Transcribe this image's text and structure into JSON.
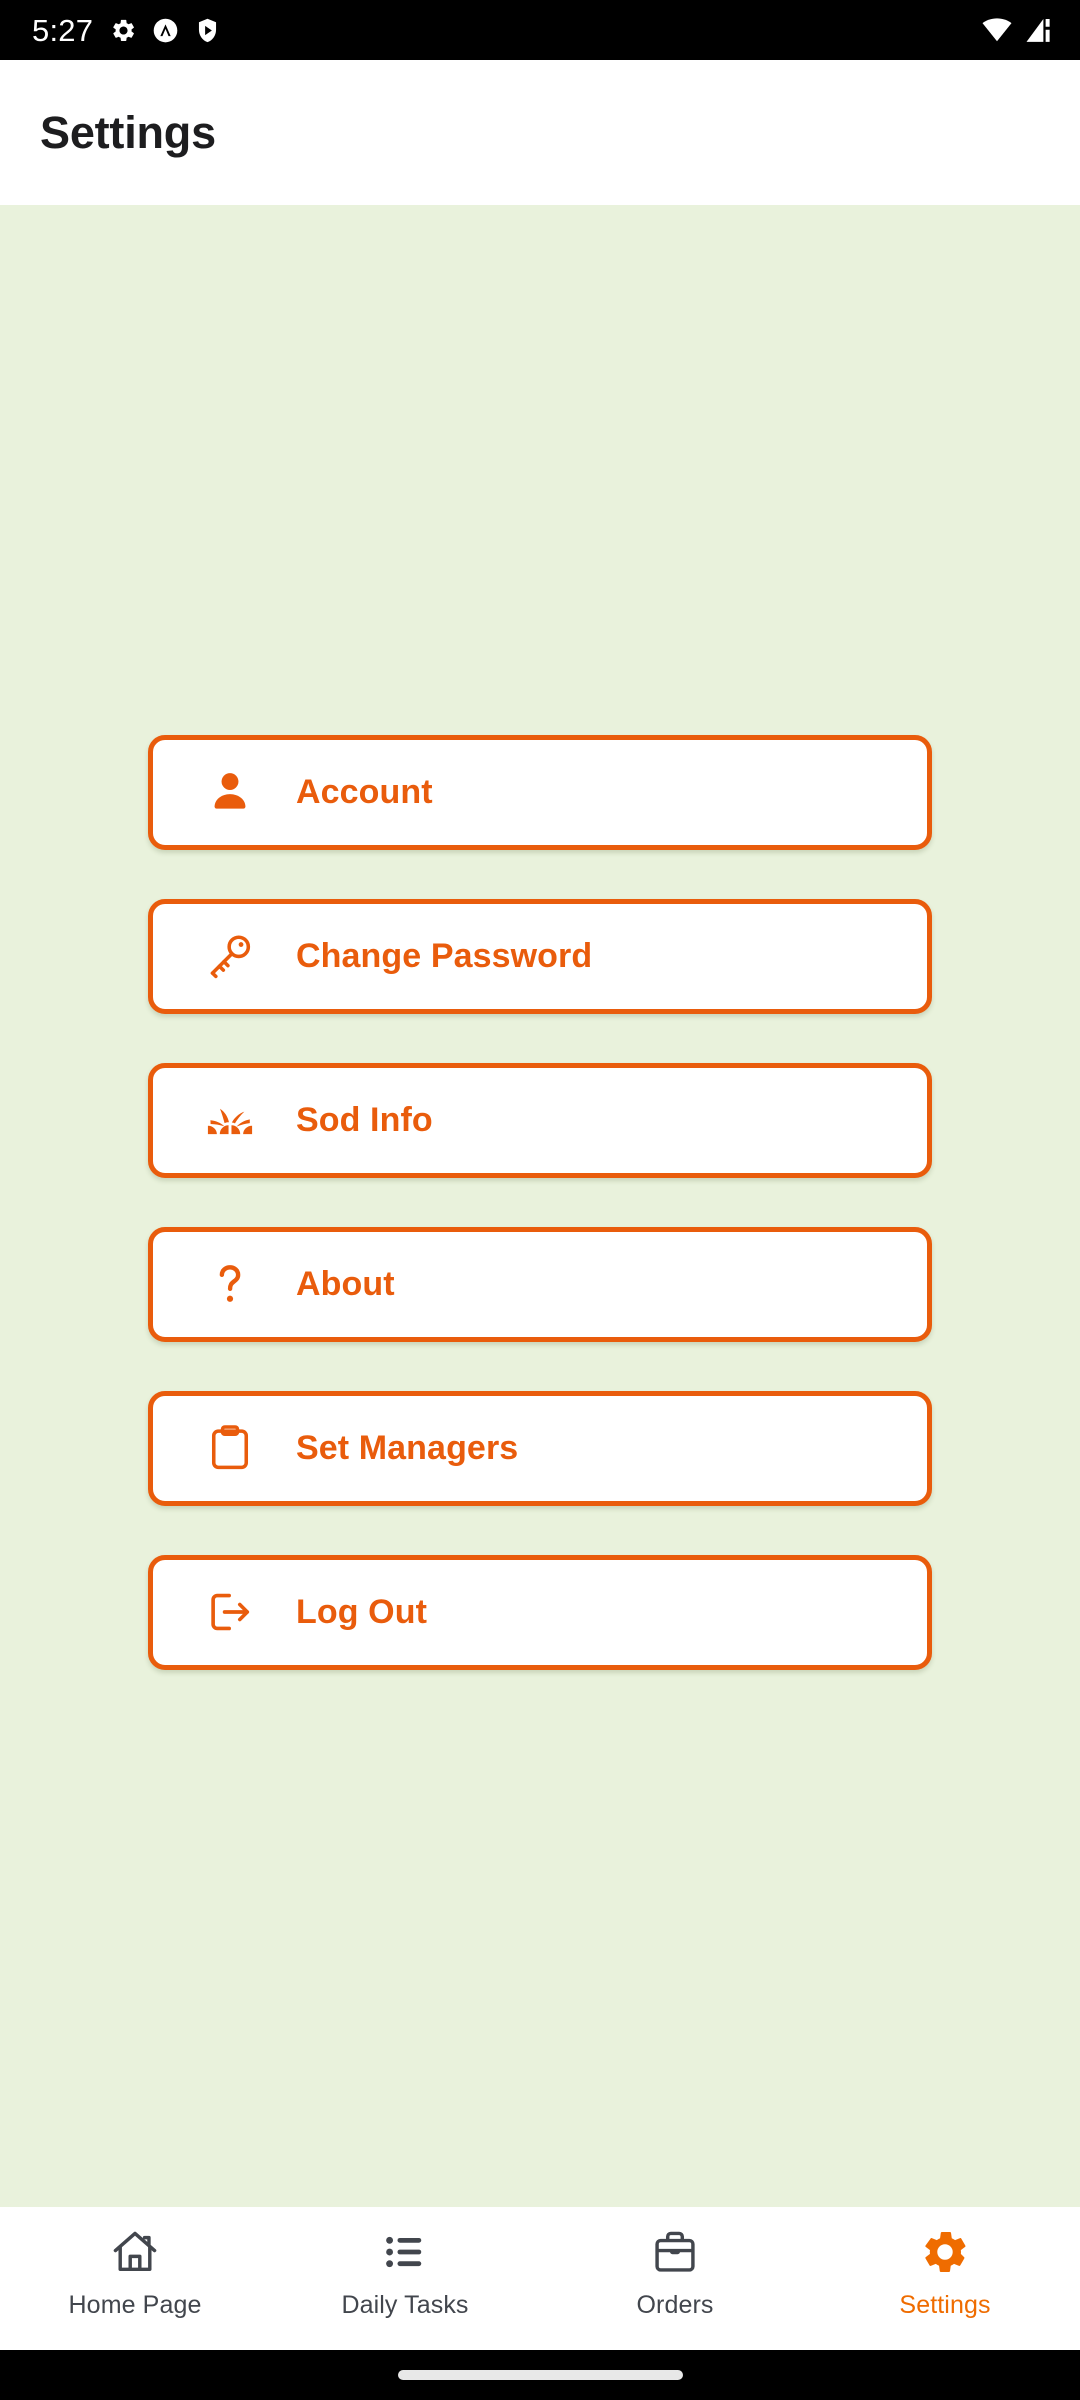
{
  "status_bar": {
    "time": "5:27",
    "left_icons": [
      "gear-icon",
      "circle-caret-up-icon",
      "play-shield-icon"
    ],
    "right_icons": [
      "wifi-icon",
      "cellular-signal-icon"
    ],
    "background_color": "#000000"
  },
  "app_bar": {
    "title": "Settings",
    "background_color": "#ffffff",
    "title_color": "#1d1d1f"
  },
  "theme": {
    "accent_color": "#e95c0c",
    "content_background": "#e9f2dc",
    "nav_active_color": "#ef6c00",
    "nav_inactive_color": "#42464d"
  },
  "menu": {
    "items": [
      {
        "label": "Account",
        "icon": "person-icon"
      },
      {
        "label": "Change Password",
        "icon": "key-icon"
      },
      {
        "label": "Sod Info",
        "icon": "grass-icon"
      },
      {
        "label": "About",
        "icon": "question-mark-icon"
      },
      {
        "label": "Set Managers",
        "icon": "clipboard-icon"
      },
      {
        "label": "Log Out",
        "icon": "logout-icon"
      }
    ]
  },
  "bottom_nav": {
    "items": [
      {
        "label": "Home Page",
        "icon": "home-icon",
        "active": false
      },
      {
        "label": "Daily Tasks",
        "icon": "list-icon",
        "active": false
      },
      {
        "label": "Orders",
        "icon": "briefcase-icon",
        "active": false
      },
      {
        "label": "Settings",
        "icon": "gear-icon",
        "active": true
      }
    ]
  }
}
